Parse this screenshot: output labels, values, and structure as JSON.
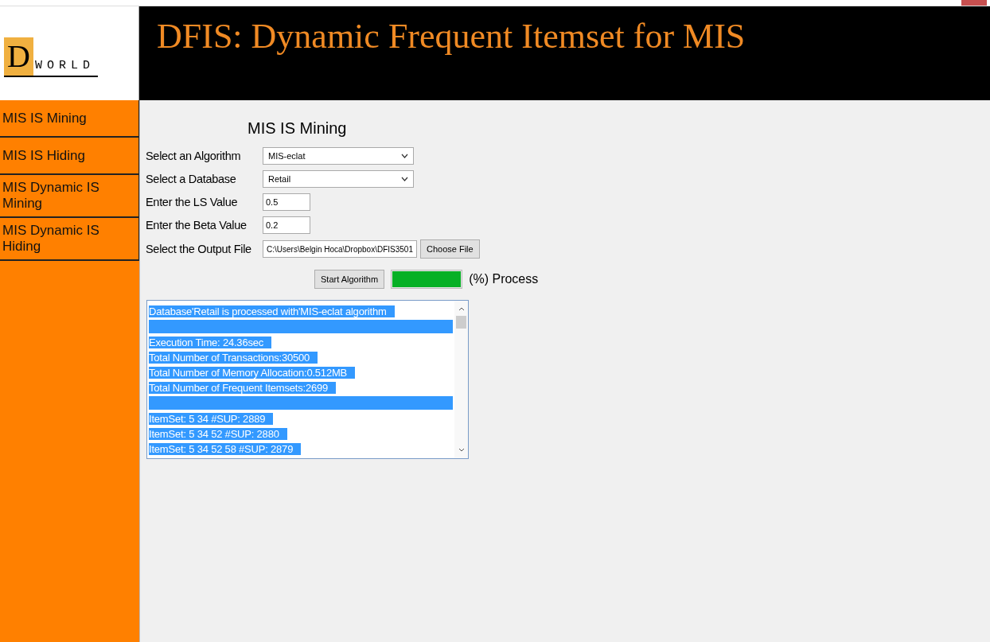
{
  "logo": {
    "initial": "D",
    "word": "WORLD"
  },
  "header": {
    "title": "DFIS: Dynamic Frequent Itemset for MIS"
  },
  "sidebar": {
    "items": [
      {
        "label": "MIS IS Mining"
      },
      {
        "label": "MIS IS Hiding"
      },
      {
        "label": "MIS Dynamic IS Mining"
      },
      {
        "label": "MIS Dynamic IS Hiding"
      }
    ]
  },
  "form": {
    "heading": "MIS IS Mining",
    "fields": [
      {
        "kind": "select",
        "label": "Select an Algorithm",
        "value": "MIS-eclat"
      },
      {
        "kind": "select",
        "label": "Select a Database",
        "value": "Retail"
      },
      {
        "kind": "text",
        "label": "Enter the LS Value",
        "value": "0.5"
      },
      {
        "kind": "text",
        "label": "Enter the Beta Value",
        "value": "0.2"
      },
      {
        "kind": "file",
        "label": "Select the Output File",
        "value": "C:\\Users\\Belgin Hoca\\Dropbox\\DFIS3501",
        "button": "Choose File"
      }
    ],
    "start_button": "Start Algorithm",
    "progress": {
      "level": 1,
      "label": "(%) Process"
    }
  },
  "output": {
    "lines": [
      {
        "kind": "text",
        "text": "Database'Retail is processed with'MIS-eclat algorithm"
      },
      {
        "kind": "rule"
      },
      {
        "kind": "text",
        "text": "Execution Time: 24.36sec"
      },
      {
        "kind": "text",
        "text": "Total Number of Transactions:30500"
      },
      {
        "kind": "text",
        "text": "Total Number of Memory Allocation:0.512MB"
      },
      {
        "kind": "text",
        "text": "Total Number of Frequent Itemsets:2699"
      },
      {
        "kind": "rule"
      },
      {
        "kind": "text",
        "text": "ItemSet: 5 34 #SUP: 2889"
      },
      {
        "kind": "text",
        "text": "ItemSet: 5 34 52 #SUP: 2880"
      },
      {
        "kind": "text",
        "text": "ItemSet: 5 34 52 58 #SUP: 2879"
      }
    ]
  }
}
